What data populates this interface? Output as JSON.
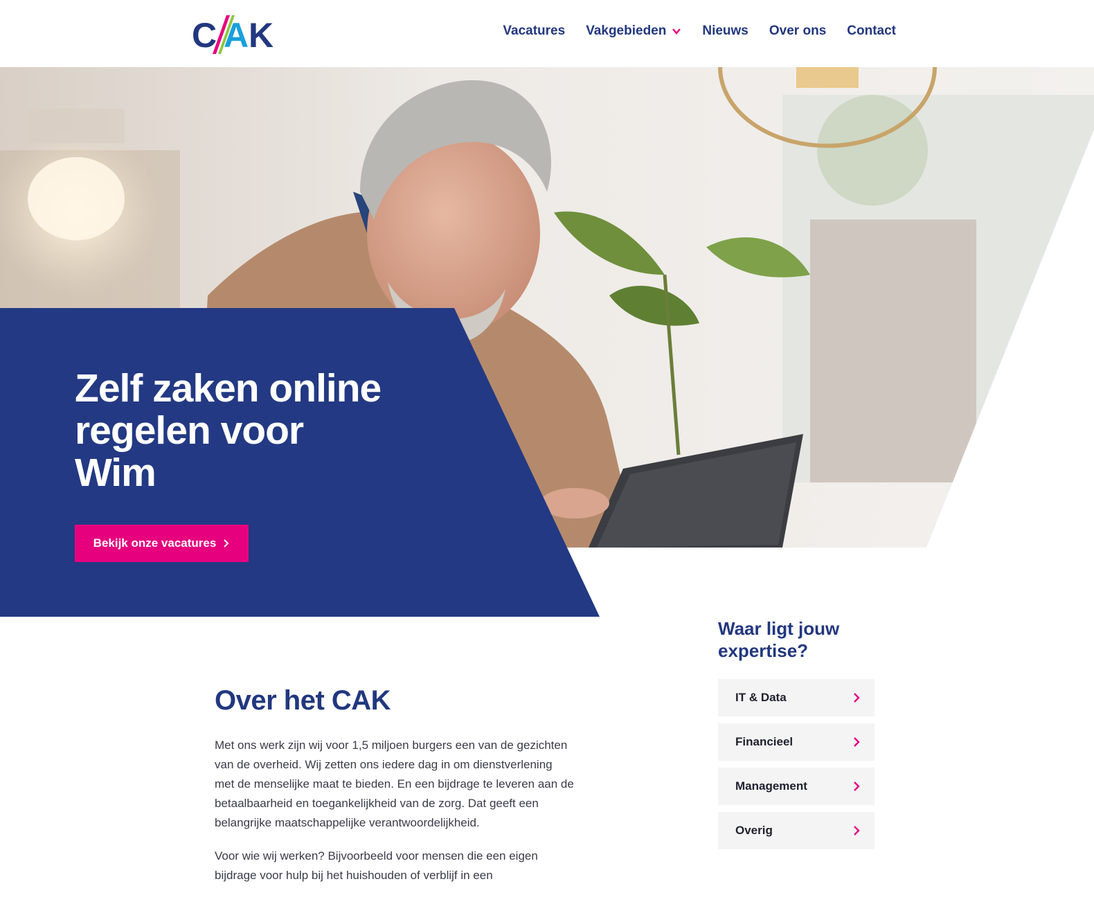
{
  "brand": {
    "logo_text_left": "C",
    "logo_text_mid": "A",
    "logo_text_right": "K",
    "navy": "#22377f",
    "pink": "#e6007e",
    "panel": "#233983"
  },
  "nav": {
    "items": [
      {
        "label": "Vacatures"
      },
      {
        "label": "Vakgebieden",
        "has_dropdown": true
      },
      {
        "label": "Nieuws"
      },
      {
        "label": "Over ons"
      },
      {
        "label": "Contact"
      }
    ]
  },
  "hero": {
    "title": "Zelf zaken online regelen voor Wim",
    "cta_label": "Bekijk onze vacatures",
    "image_subject": "older man with grey hair using a tablet at home"
  },
  "about": {
    "heading": "Over het CAK",
    "paragraphs": [
      "Met ons werk zijn wij voor 1,5 miljoen burgers een van de gezichten van de overheid. Wij zetten ons iedere dag in om dienstverlening met de menselijke maat te bieden. En een bijdrage te leveren aan de betaalbaarheid en toegankelijkheid van de zorg. Dat geeft een belangrijke maatschappelijke verantwoordelijkheid.",
      "Voor wie wij werken? Bijvoorbeeld voor mensen die een eigen bijdrage voor hulp bij het huishouden of verblijf in een"
    ]
  },
  "expertise": {
    "heading": "Waar ligt jouw expertise?",
    "items": [
      {
        "label": "IT & Data"
      },
      {
        "label": "Financieel"
      },
      {
        "label": "Management"
      },
      {
        "label": "Overig"
      }
    ]
  }
}
